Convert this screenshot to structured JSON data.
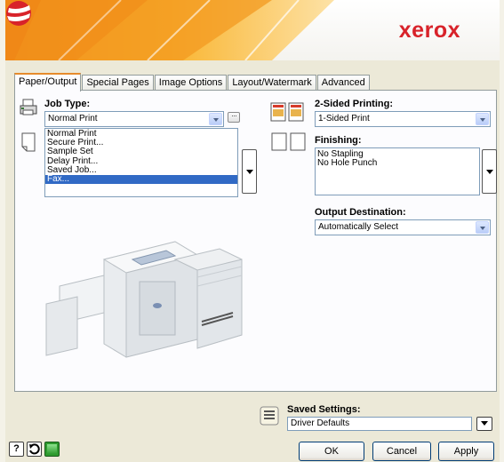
{
  "brand": {
    "logo_text": "xerox",
    "accent_color": "#d8232a",
    "banner_orange": "#f7a31c"
  },
  "tabs": [
    {
      "label": "Paper/Output",
      "active": true
    },
    {
      "label": "Special Pages"
    },
    {
      "label": "Image Options"
    },
    {
      "label": "Layout/Watermark"
    },
    {
      "label": "Advanced"
    }
  ],
  "job_type": {
    "label": "Job Type:",
    "value": "Normal Print",
    "options": [
      "Normal Print",
      "Secure Print...",
      "Sample Set",
      "Delay Print...",
      "Saved Job...",
      "Fax..."
    ],
    "highlighted": "Fax..."
  },
  "two_sided": {
    "label": "2-Sided Printing:",
    "value": "1-Sided Print"
  },
  "finishing": {
    "label": "Finishing:",
    "items": [
      "No Stapling",
      "No Hole Punch"
    ]
  },
  "output_destination": {
    "label": "Output Destination:",
    "value": "Automatically Select"
  },
  "saved_settings": {
    "label": "Saved Settings:",
    "value": "Driver Defaults"
  },
  "buttons": {
    "ok": "OK",
    "cancel": "Cancel",
    "apply": "Apply",
    "help": "?"
  },
  "icons": [
    "printer-icon",
    "page-icon",
    "duplex-icon",
    "finishing-icon",
    "saved-settings-icon",
    "help-icon",
    "restore-icon",
    "status-icon",
    "xerox-logo-icon",
    "printer-illustration"
  ]
}
